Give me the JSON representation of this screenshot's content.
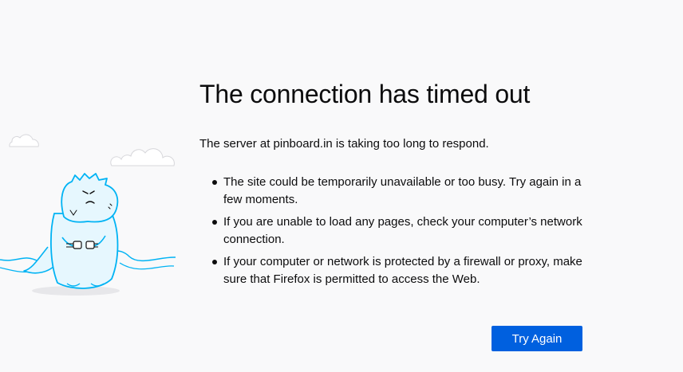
{
  "error": {
    "title": "The connection has timed out",
    "description": "The server at pinboard.in is taking too long to respond.",
    "bullets": [
      "The site could be temporarily unavailable or too busy. Try again in a few moments.",
      "If you are unable to load any pages, check your computer’s network connection.",
      "If your computer or network is protected by a firewall or proxy, make sure that Firefox is permitted to access the Web."
    ]
  },
  "actions": {
    "try_again_label": "Try Again"
  },
  "illustration": {
    "icon": "unplugged-dinosaur-illustration",
    "accent_color": "#00b3f4"
  },
  "colors": {
    "background": "#f9f9fa",
    "button": "#0060df",
    "text": "#0c0c0d"
  }
}
